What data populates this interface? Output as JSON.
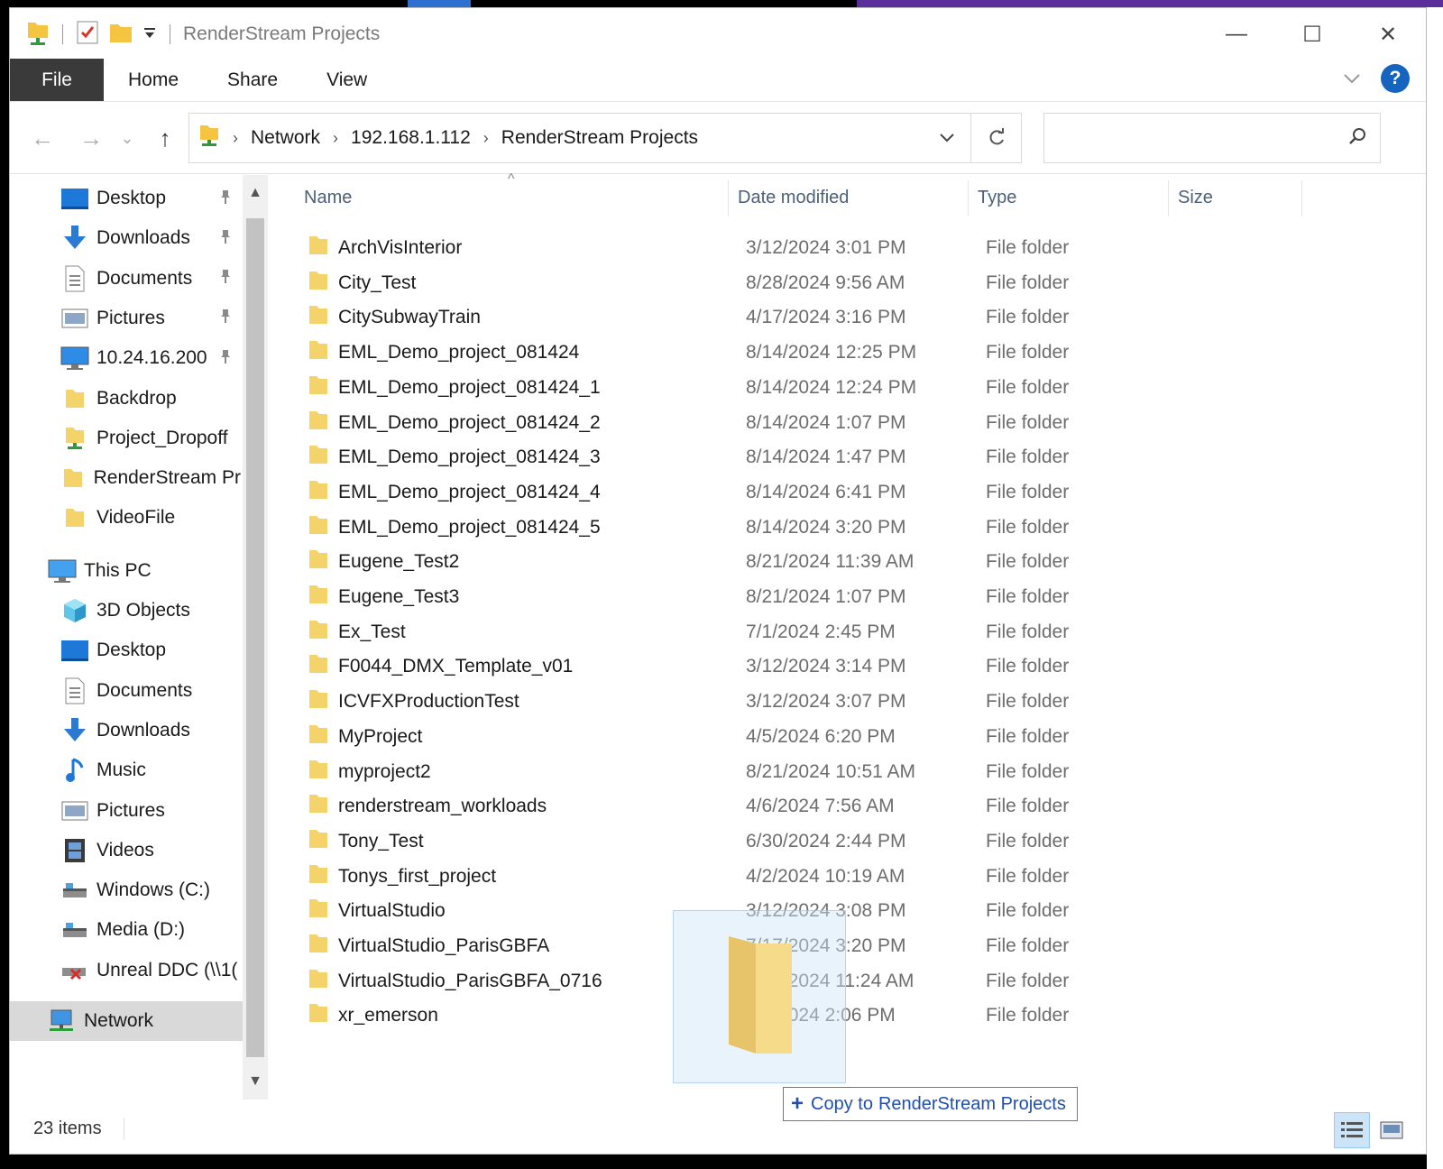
{
  "window": {
    "title": "RenderStream Projects",
    "controls": {
      "minimize": "—",
      "maximize": "☐",
      "close": "✕"
    }
  },
  "ribbon": {
    "tabs": [
      "File",
      "Home",
      "Share",
      "View"
    ],
    "help": "?"
  },
  "nav": {
    "back": "←",
    "forward": "→",
    "recent": "⌄",
    "up": "↑",
    "breadcrumbs": [
      "Network",
      "192.168.1.112",
      "RenderStream Projects"
    ],
    "search_placeholder": ""
  },
  "sidebar": {
    "quick_access": [
      {
        "label": "Desktop",
        "icon": "desktop-icon",
        "pinned": true
      },
      {
        "label": "Downloads",
        "icon": "downloads-icon",
        "pinned": true
      },
      {
        "label": "Documents",
        "icon": "documents-icon",
        "pinned": true
      },
      {
        "label": "Pictures",
        "icon": "pictures-icon",
        "pinned": true
      },
      {
        "label": "10.24.16.200",
        "icon": "monitor-icon",
        "pinned": true
      },
      {
        "label": "Backdrop",
        "icon": "folder-icon",
        "pinned": false
      },
      {
        "label": "Project_Dropoff",
        "icon": "network-folder-icon",
        "pinned": false
      },
      {
        "label": "RenderStream Pr",
        "icon": "folder-icon",
        "pinned": false
      },
      {
        "label": "VideoFile",
        "icon": "folder-icon",
        "pinned": false
      }
    ],
    "this_pc": {
      "label": "This PC"
    },
    "this_pc_items": [
      {
        "label": "3D Objects",
        "icon": "cube-icon"
      },
      {
        "label": "Desktop",
        "icon": "desktop-icon"
      },
      {
        "label": "Documents",
        "icon": "documents-icon"
      },
      {
        "label": "Downloads",
        "icon": "downloads-icon"
      },
      {
        "label": "Music",
        "icon": "music-icon"
      },
      {
        "label": "Pictures",
        "icon": "pictures-icon"
      },
      {
        "label": "Videos",
        "icon": "videos-icon"
      },
      {
        "label": "Windows (C:)",
        "icon": "drive-icon"
      },
      {
        "label": "Media (D:)",
        "icon": "drive-icon"
      },
      {
        "label": "Unreal DDC (\\\\1(",
        "icon": "disconnected-drive-icon"
      }
    ],
    "network": {
      "label": "Network"
    }
  },
  "columns": {
    "name": "Name",
    "date": "Date modified",
    "type": "Type",
    "size": "Size"
  },
  "files": [
    {
      "name": "ArchVisInterior",
      "date": "3/12/2024 3:01 PM",
      "type": "File folder"
    },
    {
      "name": "City_Test",
      "date": "8/28/2024 9:56 AM",
      "type": "File folder"
    },
    {
      "name": "CitySubwayTrain",
      "date": "4/17/2024 3:16 PM",
      "type": "File folder"
    },
    {
      "name": "EML_Demo_project_081424",
      "date": "8/14/2024 12:25 PM",
      "type": "File folder"
    },
    {
      "name": "EML_Demo_project_081424_1",
      "date": "8/14/2024 12:24 PM",
      "type": "File folder"
    },
    {
      "name": "EML_Demo_project_081424_2",
      "date": "8/14/2024 1:07 PM",
      "type": "File folder"
    },
    {
      "name": "EML_Demo_project_081424_3",
      "date": "8/14/2024 1:47 PM",
      "type": "File folder"
    },
    {
      "name": "EML_Demo_project_081424_4",
      "date": "8/14/2024 6:41 PM",
      "type": "File folder"
    },
    {
      "name": "EML_Demo_project_081424_5",
      "date": "8/14/2024 3:20 PM",
      "type": "File folder"
    },
    {
      "name": "Eugene_Test2",
      "date": "8/21/2024 11:39 AM",
      "type": "File folder"
    },
    {
      "name": "Eugene_Test3",
      "date": "8/21/2024 1:07 PM",
      "type": "File folder"
    },
    {
      "name": "Ex_Test",
      "date": "7/1/2024 2:45 PM",
      "type": "File folder"
    },
    {
      "name": "F0044_DMX_Template_v01",
      "date": "3/12/2024 3:14 PM",
      "type": "File folder"
    },
    {
      "name": "ICVFXProductionTest",
      "date": "3/12/2024 3:07 PM",
      "type": "File folder"
    },
    {
      "name": "MyProject",
      "date": "4/5/2024 6:20 PM",
      "type": "File folder"
    },
    {
      "name": "myproject2",
      "date": "8/21/2024 10:51 AM",
      "type": "File folder"
    },
    {
      "name": "renderstream_workloads",
      "date": "4/6/2024 7:56 AM",
      "type": "File folder"
    },
    {
      "name": "Tony_Test",
      "date": "6/30/2024 2:44 PM",
      "type": "File folder"
    },
    {
      "name": "Tonys_first_project",
      "date": "4/2/2024 10:19 AM",
      "type": "File folder"
    },
    {
      "name": "VirtualStudio",
      "date": "3/12/2024 3:08 PM",
      "type": "File folder"
    },
    {
      "name": "VirtualStudio_ParisGBFA",
      "date": "7/17/2024 3:20 PM",
      "type": "File folder"
    },
    {
      "name": "VirtualStudio_ParisGBFA_0716",
      "date": "7/17/2024 11:24 AM",
      "type": "File folder"
    },
    {
      "name": "xr_emerson",
      "date": "5/9/2024 2:06 PM",
      "type": "File folder"
    }
  ],
  "drop_tooltip": {
    "plus": "+",
    "verb": "Copy to",
    "target": "RenderStream Projects"
  },
  "status": {
    "count": "23 items"
  },
  "colors": {
    "folder": "#f5d36b",
    "accent": "#1565c0",
    "file_tab": "#3a3a3a"
  }
}
